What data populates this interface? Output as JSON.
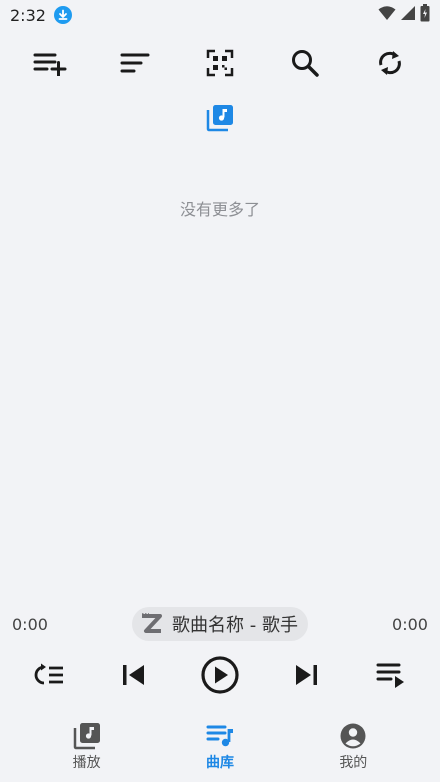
{
  "status_bar": {
    "time": "2:32",
    "icons": [
      "download-icon",
      "wifi-icon",
      "signal-icon",
      "battery-icon"
    ]
  },
  "toolbar": {
    "icons": [
      "playlist-add-icon",
      "sort-icon",
      "qr-scan-icon",
      "search-icon",
      "sync-icon"
    ]
  },
  "library": {
    "icon": "library-music-icon",
    "empty_text": "没有更多了"
  },
  "player": {
    "elapsed": "0:00",
    "duration": "0:00",
    "song_label": "歌曲名称 - 歌手",
    "artwork_icon": "z-logo-icon",
    "controls": [
      "repeat-list-icon",
      "skip-previous-icon",
      "play-icon",
      "skip-next-icon",
      "queue-icon"
    ]
  },
  "bottom_nav": {
    "items": [
      {
        "label": "播放",
        "icon": "library-music-icon"
      },
      {
        "label": "曲库",
        "icon": "playlist-music-icon",
        "active": true
      },
      {
        "label": "我的",
        "icon": "account-icon"
      }
    ]
  },
  "colors": {
    "accent": "#1e88e5",
    "background": "#f2f3f6",
    "icon": "#1a1a1a"
  }
}
